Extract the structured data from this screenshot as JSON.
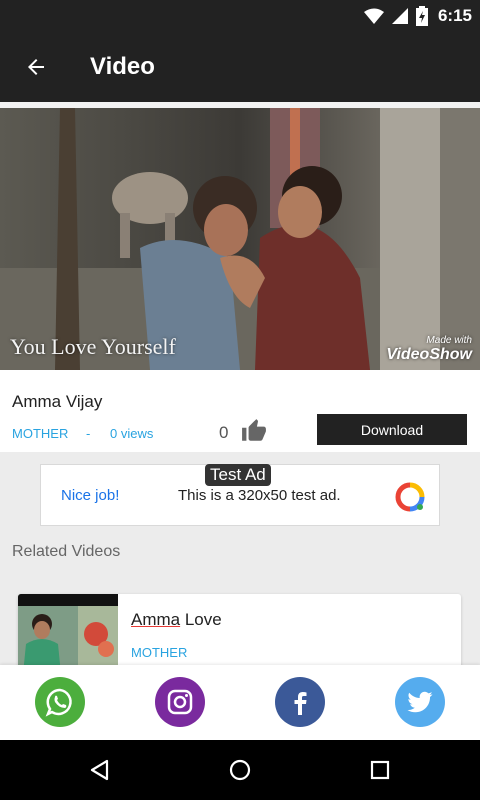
{
  "status_bar": {
    "time": "6:15"
  },
  "app_bar": {
    "title": "Video"
  },
  "video": {
    "caption": "You Love Yourself",
    "watermark_small": "Made with",
    "watermark_big": "VideoShow",
    "title": "Amma Vijay",
    "category": "MOTHER",
    "separator": "-",
    "views": "0 views",
    "likes": "0",
    "download_label": "Download"
  },
  "ad": {
    "tag": "Test Ad",
    "headline": "Nice job!",
    "body": "This is a 320x50 test ad."
  },
  "related": {
    "heading": "Related Videos",
    "items": [
      {
        "title_part1": "Amma",
        "title_part2": " Love",
        "category": "MOTHER"
      }
    ]
  },
  "share": {
    "icons": [
      "whatsapp-icon",
      "instagram-icon",
      "facebook-icon",
      "twitter-icon"
    ],
    "colors": {
      "whatsapp": "#4cae3d",
      "instagram": "#7a2a9e",
      "facebook": "#3b5998",
      "twitter": "#55acee"
    }
  },
  "colors": {
    "appbar": "#222222",
    "link": "#29a3e0",
    "download": "#222222"
  }
}
